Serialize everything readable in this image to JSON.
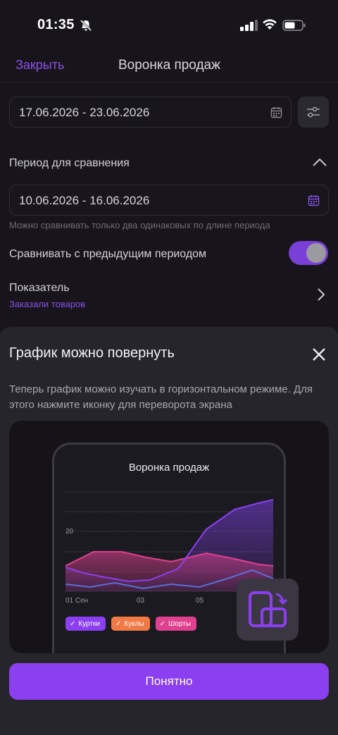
{
  "status_bar": {
    "time": "01:35"
  },
  "header": {
    "close_label": "Закрыть",
    "title": "Воронка продаж"
  },
  "date_range": {
    "value": "17.06.2026 - 23.06.2026"
  },
  "comparison": {
    "label": "Период для сравнения",
    "date_range": "10.06.2026 - 16.06.2026",
    "hint": "Можно сравнивать только два одинаковых по длине периода"
  },
  "compare_toggle": {
    "label": "Сравнивать с предыдущим периодом",
    "on": true
  },
  "metric": {
    "label": "Показатель",
    "value": "Заказали товаров"
  },
  "sheet": {
    "title": "График можно повернуть",
    "description": "Теперь график можно изучать в горизонтальном режиме. Для этого нажмите иконку для переворота экрана",
    "preview": {
      "title": "Воронка продаж",
      "y_tick": "20",
      "x_ticks": [
        "01 Сен",
        "03",
        "05"
      ],
      "legend": [
        {
          "label": "Куртки",
          "color": "#8b3ff0"
        },
        {
          "label": "Куклы",
          "color": "#f07a45"
        },
        {
          "label": "Шорты",
          "color": "#e0408f"
        }
      ]
    },
    "confirm_label": "Понятно"
  },
  "colors": {
    "accent": "#8b3ff0",
    "background": "#17151b",
    "sheet": "#27252c"
  }
}
